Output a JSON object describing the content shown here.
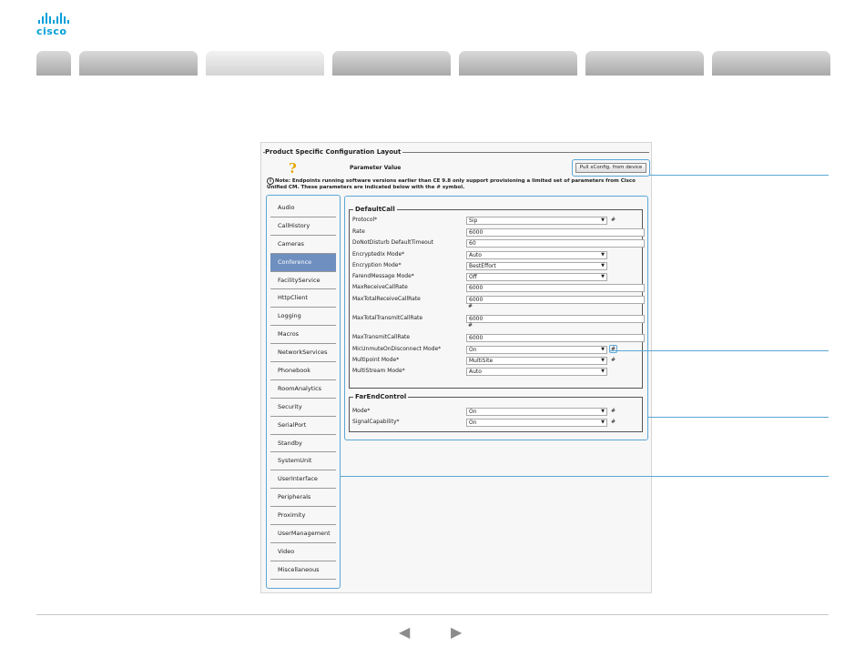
{
  "brand": {
    "name": "cisco"
  },
  "colors": {
    "brand": "#049fd9",
    "accent": "#5aa7d6",
    "selected": "#6e8fbf"
  },
  "config": {
    "title": "Product Specific Configuration Layout",
    "parameter_value_label": "Parameter Value",
    "pull_button": "Pull xConfig. from device",
    "note": "Note: Endpoints running software versions earlier than CE 9.8 only support provisioning a limited set of parameters from Cisco Unified CM. These parameters are indicated below with the # symbol."
  },
  "sidebar": {
    "items": [
      "Audio",
      "CallHistory",
      "Cameras",
      "Conference",
      "FacilityService",
      "HttpClient",
      "Logging",
      "Macros",
      "NetworkServices",
      "Phonebook",
      "RoomAnalytics",
      "Security",
      "SerialPort",
      "Standby",
      "SystemUnit",
      "UserInterface",
      "Peripherals",
      "Proximity",
      "UserManagement",
      "Video",
      "Miscellaneous"
    ],
    "selected": "Conference"
  },
  "default_call": {
    "title": "DefaultCall",
    "rows": [
      {
        "label": "Protocol*",
        "value": "Sip",
        "type": "select",
        "hash": "#"
      },
      {
        "label": "Rate",
        "value": "6000",
        "type": "text",
        "hash": ""
      },
      {
        "label": "DoNotDisturb DefaultTimeout",
        "value": "60",
        "type": "text",
        "hash": ""
      },
      {
        "label": "EncryptedIx Mode*",
        "value": "Auto",
        "type": "select",
        "hash": ""
      },
      {
        "label": "Encryption Mode*",
        "value": "BestEffort",
        "type": "select",
        "hash": ""
      },
      {
        "label": "FarendMessage Mode*",
        "value": "Off",
        "type": "select",
        "hash": ""
      },
      {
        "label": "MaxReceiveCallRate",
        "value": "6000",
        "type": "text",
        "hash": ""
      },
      {
        "label": "MaxTotalReceiveCallRate",
        "value": "6000",
        "type": "text",
        "hash": "#"
      },
      {
        "label": "MaxTotalTransmitCallRate",
        "value": "6000",
        "type": "text",
        "hash": "#"
      },
      {
        "label": "MaxTransmitCallRate",
        "value": "6000",
        "type": "text",
        "hash": ""
      },
      {
        "label": "MicUnmuteOnDisconnect Mode*",
        "value": "On",
        "type": "select",
        "hash": "#"
      },
      {
        "label": "Multipoint Mode*",
        "value": "MultiSite",
        "type": "select",
        "hash": "#"
      },
      {
        "label": "MultiStream Mode*",
        "value": "Auto",
        "type": "select",
        "hash": ""
      }
    ]
  },
  "far_end_control": {
    "title": "FarEndControl",
    "rows": [
      {
        "label": "Mode*",
        "value": "On",
        "type": "select",
        "hash": "#"
      },
      {
        "label": "SignalCapability*",
        "value": "On",
        "type": "select",
        "hash": "#"
      }
    ]
  },
  "icons": {
    "help": "question-mark-icon",
    "info": "info-icon",
    "prev": "arrow-left-icon",
    "next": "arrow-right-icon"
  },
  "footer": {
    "prev_symbol": "◀",
    "next_symbol": "▶"
  }
}
